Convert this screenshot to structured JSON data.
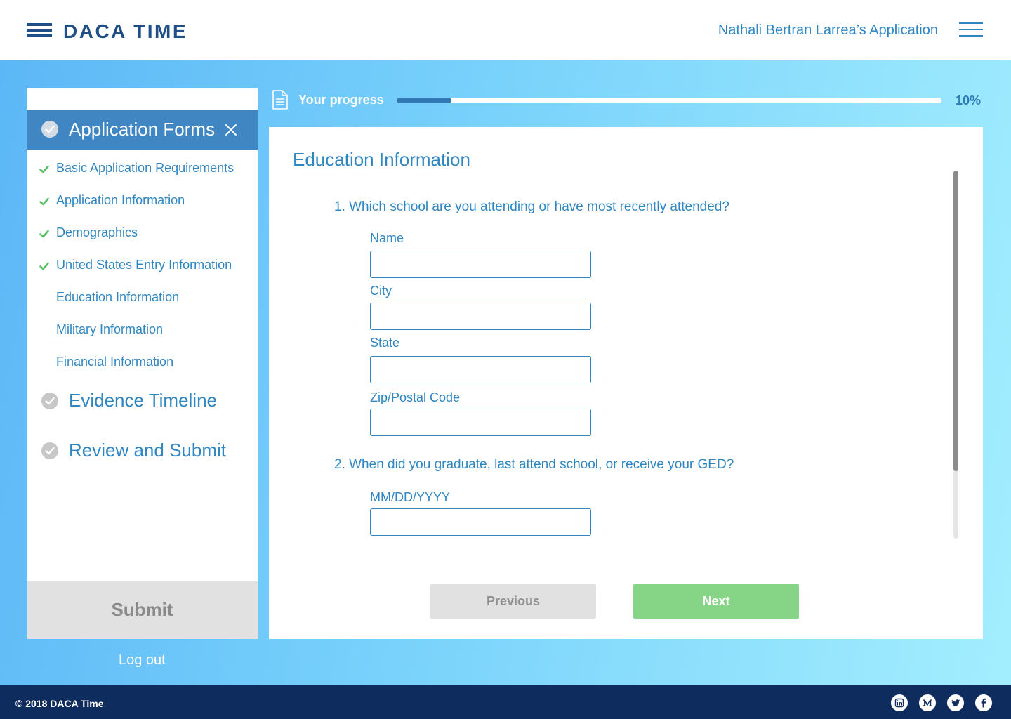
{
  "header": {
    "logo_text": "DACA TIME",
    "application_name": "Nathali Bertran Larrea’s Application",
    "menu_icon": "hamburger-menu-icon"
  },
  "sidebar": {
    "active_section": {
      "title": "Application Forms",
      "completed": true
    },
    "items": [
      {
        "label": "Basic Application Requirements",
        "completed": true
      },
      {
        "label": "Application Information",
        "completed": true
      },
      {
        "label": "Demographics",
        "completed": true
      },
      {
        "label": "United States Entry Information",
        "completed": true
      },
      {
        "label": "Education Information",
        "completed": false
      },
      {
        "label": "Military Information",
        "completed": false
      },
      {
        "label": "Financial Information",
        "completed": false
      }
    ],
    "sections": [
      {
        "title": "Evidence Timeline"
      },
      {
        "title": "Review and Submit"
      }
    ],
    "submit_label": "Submit"
  },
  "logout_label": "Log out",
  "progress": {
    "label": "Your progress",
    "value": 0.1,
    "percent_text": "10%"
  },
  "form": {
    "title": "Education Information",
    "question1": "1. Which school are you attending or have most recently attended?",
    "fields": {
      "name_label": "Name",
      "city_label": "City",
      "state_label": "State",
      "zip_label": "Zip/Postal Code",
      "name_value": "",
      "city_value": "",
      "state_value": "",
      "zip_value": ""
    },
    "question2": "2. When did you graduate, last attend school, or receive your GED?",
    "date_label": "MM/DD/YYYY",
    "date_value": "",
    "previous_label": "Previous",
    "next_label": "Next"
  },
  "footer": {
    "copyright": "© 2018 DACA Time",
    "social_icons": [
      "linkedin-icon",
      "medium-icon",
      "twitter-icon",
      "facebook-icon"
    ]
  },
  "colors": {
    "brand_navy": "#1f4f86",
    "link_blue": "#2f86c1",
    "active_blue": "#3f86c3",
    "next_green": "#86d486",
    "footer_navy": "#0f2c5e",
    "check_green": "#5cbf6a"
  }
}
